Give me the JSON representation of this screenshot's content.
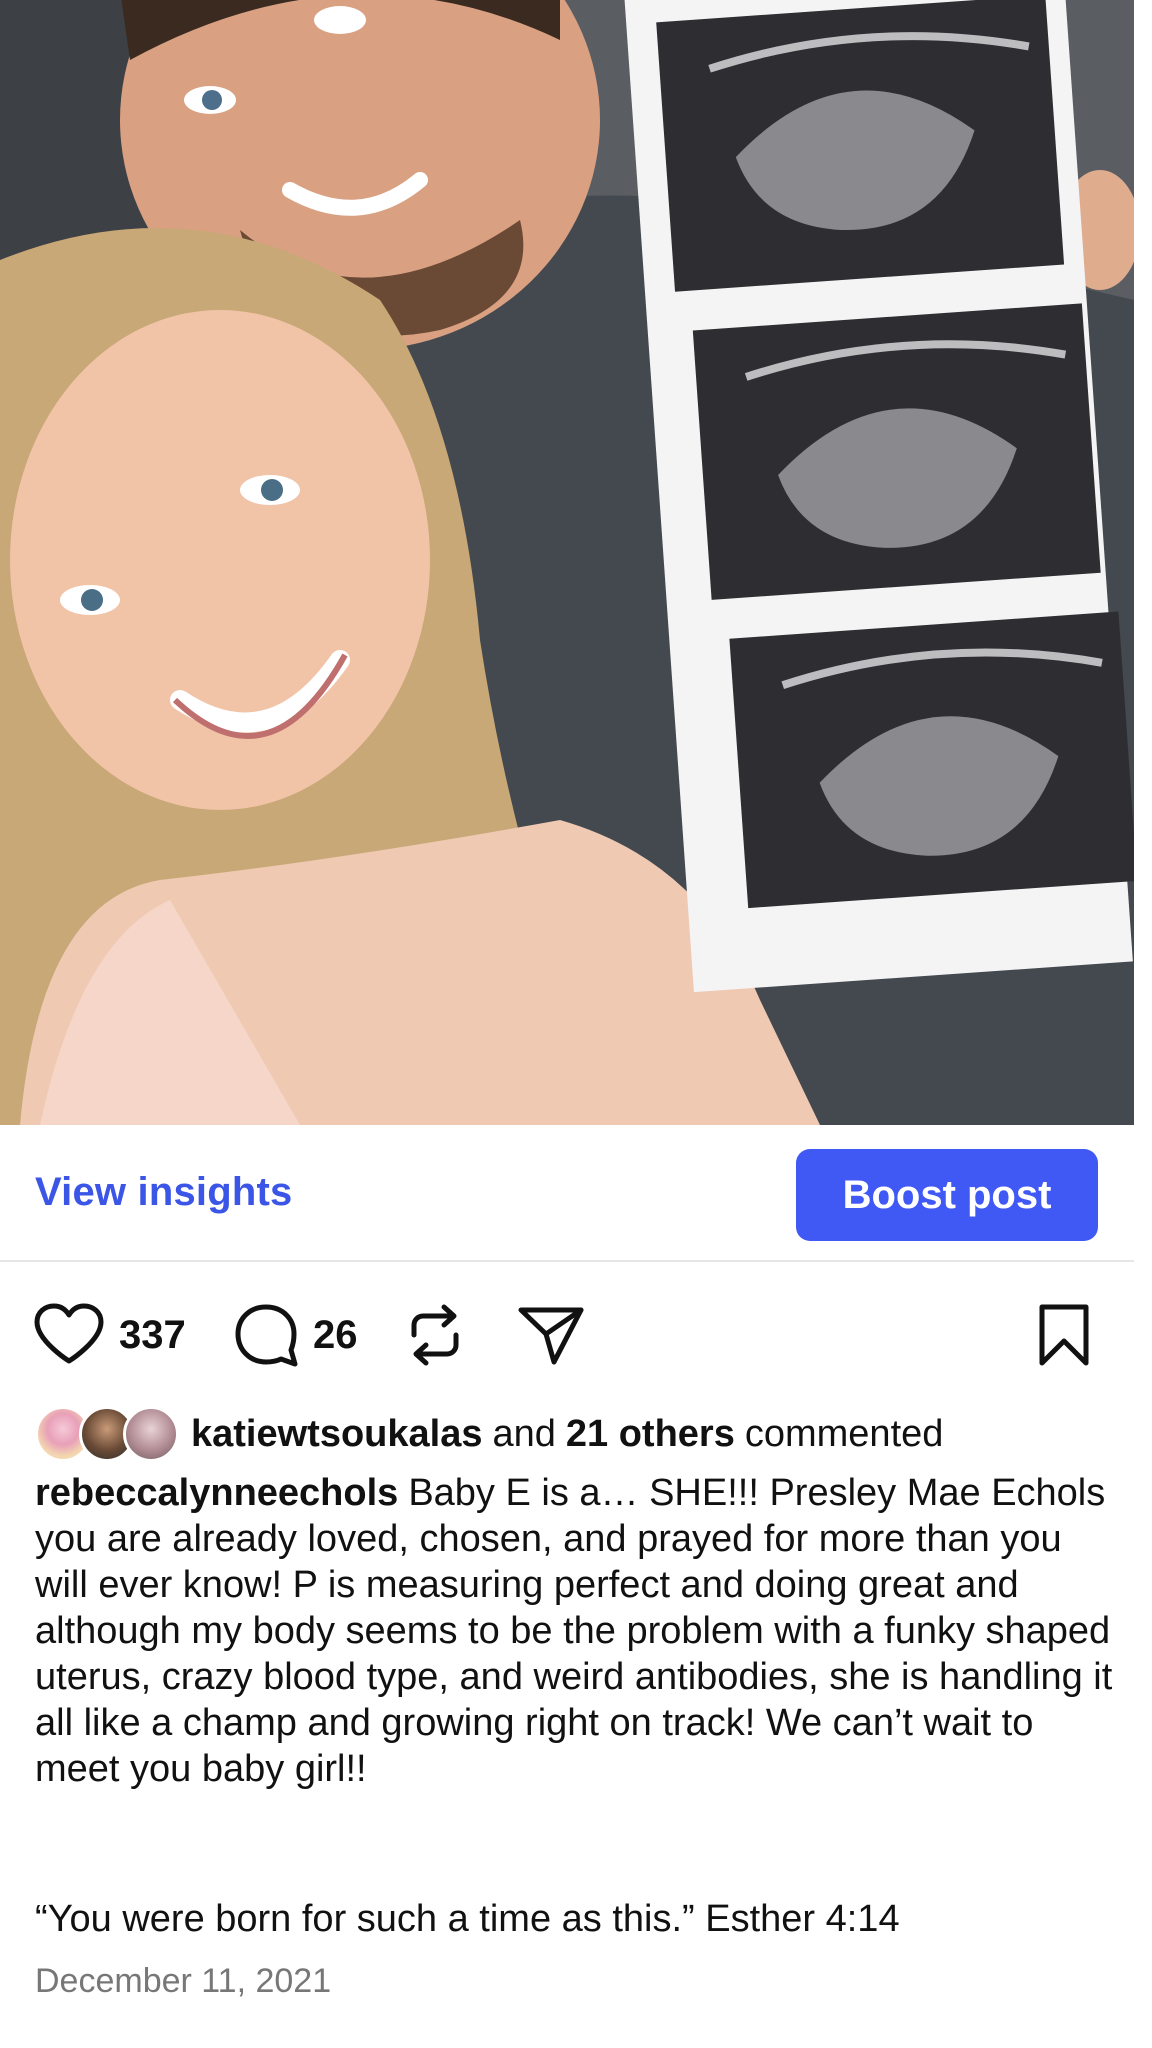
{
  "post": {
    "image_alt": "Selfie of couple holding ultrasound printouts"
  },
  "insights": {
    "view_label": "View insights",
    "boost_label": "Boost post"
  },
  "actions": {
    "likes": "337",
    "comments": "26"
  },
  "commented": {
    "user": "katiewtsoukalas",
    "and": "and",
    "others": "21 others",
    "suffix": "commented"
  },
  "caption": {
    "username": "rebeccalynneechols",
    "text": "Baby E is a… SHE!!! Presley Mae Echols you are already loved, chosen, and prayed for more than you will ever know! P is measuring perfect and doing great and although my body seems to be the problem with a funky shaped uterus, crazy blood type, and weird antibodies, she is handling it all like a champ and growing right on track! We can’t wait to meet you baby girl!!",
    "quote": "“You were born for such a time as this.” Esther 4:14"
  },
  "date": "December 11, 2021",
  "colors": {
    "accent": "#4059f5",
    "link": "#3b55e6"
  }
}
